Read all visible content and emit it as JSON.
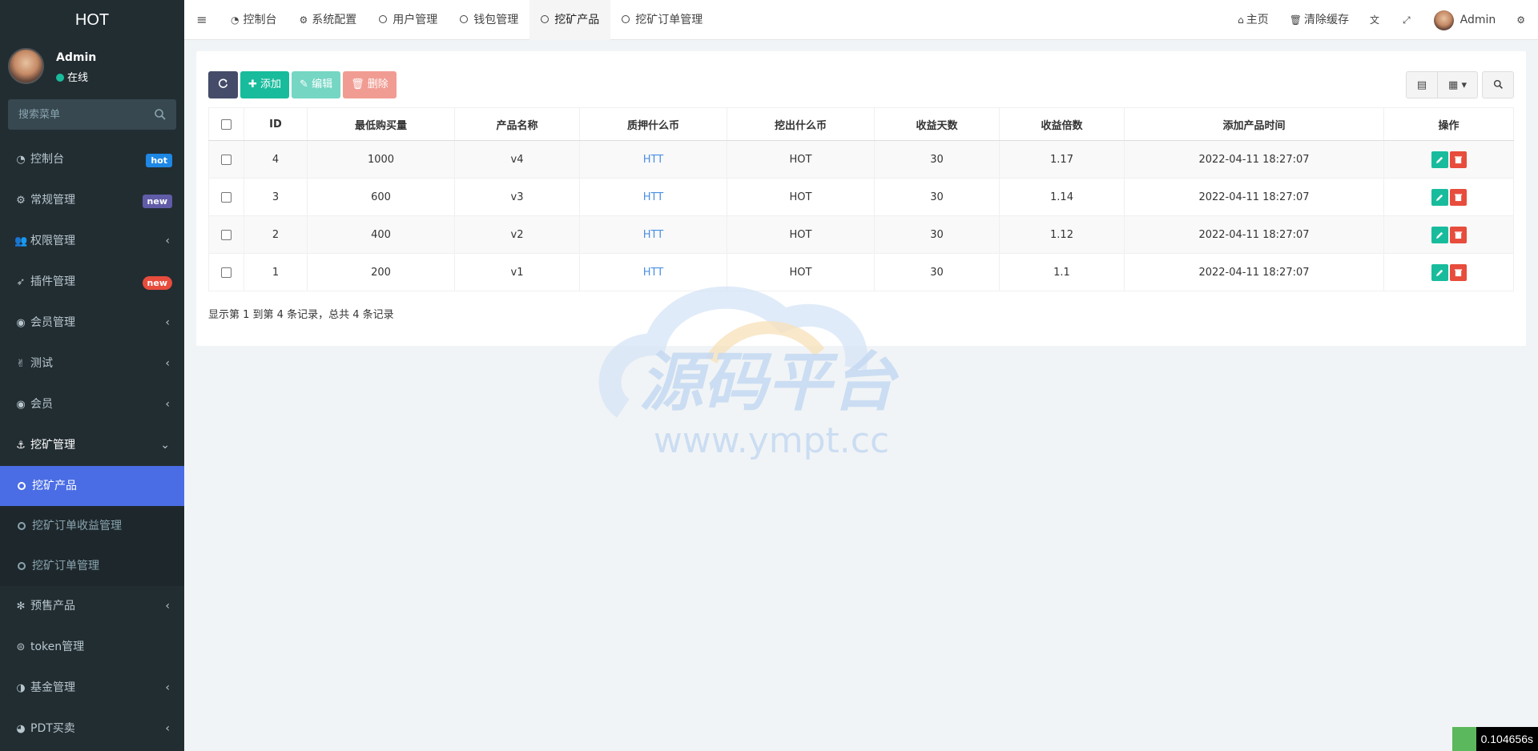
{
  "app": {
    "brand": "HOT"
  },
  "user": {
    "name": "Admin",
    "status": "在线"
  },
  "search": {
    "placeholder": "搜索菜单"
  },
  "sidebar": {
    "items": [
      {
        "label": "控制台",
        "badge": "hot"
      },
      {
        "label": "常规管理",
        "badge": "new"
      },
      {
        "label": "权限管理"
      },
      {
        "label": "插件管理",
        "badge": "new"
      },
      {
        "label": "会员管理"
      },
      {
        "label": "测试"
      },
      {
        "label": "会员"
      },
      {
        "label": "挖矿管理"
      },
      {
        "label": "预售产品"
      },
      {
        "label": "token管理"
      },
      {
        "label": "基金管理"
      },
      {
        "label": "PDT买卖"
      }
    ],
    "submenu": [
      {
        "label": "挖矿产品"
      },
      {
        "label": "挖矿订单收益管理"
      },
      {
        "label": "挖矿订单管理"
      }
    ]
  },
  "navbar": {
    "tabs": [
      {
        "label": "控制台"
      },
      {
        "label": "系统配置"
      },
      {
        "label": "用户管理"
      },
      {
        "label": "钱包管理"
      },
      {
        "label": "挖矿产品"
      },
      {
        "label": "挖矿订单管理"
      }
    ],
    "right": {
      "home": "主页",
      "clear_cache": "清除缓存",
      "user": "Admin"
    }
  },
  "toolbar": {
    "add": "添加",
    "edit": "编辑",
    "delete": "删除"
  },
  "table": {
    "headers": [
      "ID",
      "最低购买量",
      "产品名称",
      "质押什么币",
      "挖出什么币",
      "收益天数",
      "收益倍数",
      "添加产品时间",
      "操作"
    ],
    "rows": [
      {
        "id": "4",
        "min": "1000",
        "name": "v4",
        "stake": "HTT",
        "mine": "HOT",
        "days": "30",
        "mult": "1.17",
        "time": "2022-04-11 18:27:07"
      },
      {
        "id": "3",
        "min": "600",
        "name": "v3",
        "stake": "HTT",
        "mine": "HOT",
        "days": "30",
        "mult": "1.14",
        "time": "2022-04-11 18:27:07"
      },
      {
        "id": "2",
        "min": "400",
        "name": "v2",
        "stake": "HTT",
        "mine": "HOT",
        "days": "30",
        "mult": "1.12",
        "time": "2022-04-11 18:27:07"
      },
      {
        "id": "1",
        "min": "200",
        "name": "v1",
        "stake": "HTT",
        "mine": "HOT",
        "days": "30",
        "mult": "1.1",
        "time": "2022-04-11 18:27:07"
      }
    ],
    "pager_info": "显示第 1 到第 4 条记录，总共 4 条记录"
  },
  "watermark": {
    "title": "源码平台",
    "url": "www.ympt.cc"
  },
  "timer": {
    "value": "0.104656s"
  },
  "colors": {
    "sidebar_bg": "#222d32",
    "active_menu": "#4a6de5",
    "success": "#18bc9c",
    "danger": "#e74c3c",
    "link": "#4a90e2"
  }
}
